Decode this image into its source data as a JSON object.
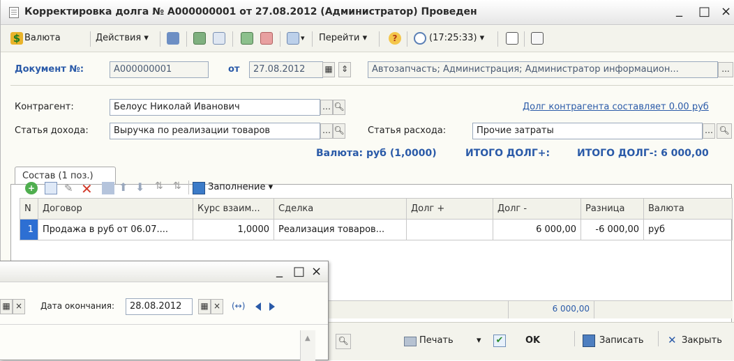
{
  "window": {
    "title": "Корректировка долга № А000000001 от 27.08.2012 (Администратор) Проведен",
    "minimize": "_",
    "maximize": "□",
    "close": "×"
  },
  "toolbar": {
    "currency": "Валюта",
    "actions": "Действия ▾",
    "navigate": "Перейти ▾",
    "time": "(17:25:33) ▾"
  },
  "header": {
    "doc_label": "Документ №:",
    "doc_number": "А000000001",
    "from_label": "от",
    "date": "27.08.2012",
    "org": "Автозапчасть; Администрация; Администратор информацион...",
    "dots": "..."
  },
  "form": {
    "contractor_label": "Контрагент:",
    "contractor": "Белоус Николай Иванович",
    "debt_link": "Долг контрагента составляет 0.00 руб",
    "income_label": "Статья дохода:",
    "income": "Выручка по реализации товаров",
    "expense_label": "Статья расхода:",
    "expense": "Прочие затраты"
  },
  "tab": {
    "label": "Состав (1 поз.)"
  },
  "summary": {
    "currency_info": "Валюта: руб (1,0000)",
    "total_plus": "ИТОГО ДОЛГ+:",
    "total_minus": "ИТОГО ДОЛГ-: 6 000,00"
  },
  "table_toolbar": {
    "fill": "Заполнение ▾"
  },
  "table": {
    "columns": [
      "N",
      "Договор",
      "Курс взаим...",
      "Сделка",
      "Долг +",
      "Долг -",
      "Разница",
      "Валюта"
    ],
    "rows": [
      [
        "1",
        "Продажа в руб от 06.07....",
        "1,0000",
        "Реализация товаров...",
        "",
        "6 000,00",
        "-6 000,00",
        "руб"
      ]
    ],
    "footer_debt_minus": "6 000,00"
  },
  "bottom": {
    "print": "Печать",
    "ok": "OK",
    "save": "Записать",
    "close": "Закрыть"
  },
  "popup": {
    "end_date_label": "Дата окончания:",
    "end_date": "28.08.2012",
    "period_icon": "(↔)"
  }
}
